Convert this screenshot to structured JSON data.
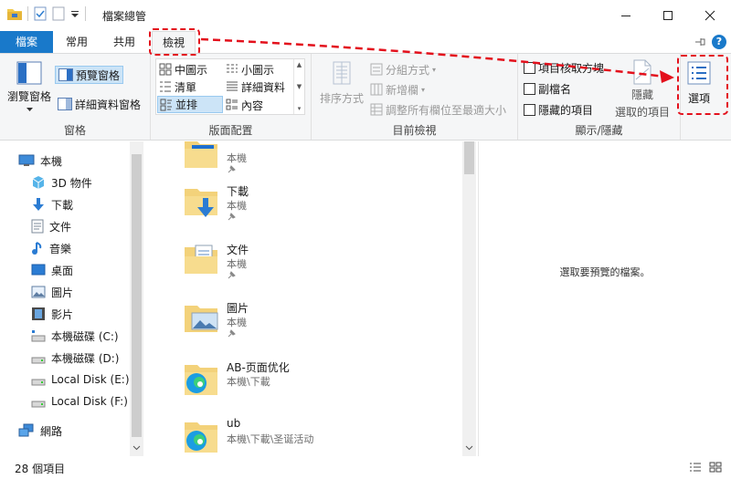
{
  "window": {
    "title": "檔案總管",
    "controls": {
      "minimize": "—",
      "maximize": "☐",
      "close": "✕"
    }
  },
  "tabs": {
    "file": "檔案",
    "home": "常用",
    "share": "共用",
    "view": "檢視"
  },
  "ribbon": {
    "panes": {
      "label": "窗格",
      "nav_pane": "瀏覽窗格",
      "preview_pane": "預覽窗格",
      "details_pane": "詳細資料窗格"
    },
    "layout": {
      "label": "版面配置",
      "items": [
        "中圖示",
        "小圖示",
        "清單",
        "詳細資料",
        "並排",
        "內容"
      ],
      "selected": "並排"
    },
    "current_view": {
      "label": "目前檢視",
      "sort_by": "排序方式",
      "group_by": "分組方式",
      "add_columns": "新增欄",
      "size_columns": "調整所有欄位至最適大小"
    },
    "show_hide": {
      "label": "顯示/隱藏",
      "item_checkboxes": "項目核取方塊",
      "file_extensions": "副檔名",
      "hidden_items": "隱藏的項目",
      "hide_selected_line1": "隱藏",
      "hide_selected_line2": "選取的項目"
    },
    "options": {
      "label": "選項"
    },
    "help": "?"
  },
  "nav": {
    "items": [
      {
        "label": "本機",
        "icon": "computer-icon"
      },
      {
        "label": "3D 物件",
        "icon": "cube-icon"
      },
      {
        "label": "下載",
        "icon": "download-icon"
      },
      {
        "label": "文件",
        "icon": "document-icon"
      },
      {
        "label": "音樂",
        "icon": "music-icon"
      },
      {
        "label": "桌面",
        "icon": "desktop-icon"
      },
      {
        "label": "圖片",
        "icon": "picture-icon"
      },
      {
        "label": "影片",
        "icon": "video-icon"
      },
      {
        "label": "本機磁碟 (C:)",
        "icon": "drive-icon"
      },
      {
        "label": "本機磁碟 (D:)",
        "icon": "drive-icon"
      },
      {
        "label": "Local Disk (E:)",
        "icon": "drive-icon"
      },
      {
        "label": "Local Disk (F:)",
        "icon": "drive-icon"
      },
      {
        "label": "網路",
        "icon": "network-icon"
      }
    ]
  },
  "files": [
    {
      "name": "",
      "location": "本機",
      "pinned": true
    },
    {
      "name": "下載",
      "location": "本機",
      "pinned": true
    },
    {
      "name": "文件",
      "location": "本機",
      "pinned": true
    },
    {
      "name": "圖片",
      "location": "本機",
      "pinned": true
    },
    {
      "name": "AB-页面优化",
      "location": "本機\\下載",
      "pinned": false
    },
    {
      "name": "ub",
      "location": "本機\\下載\\圣诞活动",
      "pinned": false
    }
  ],
  "preview": {
    "message": "選取要預覽的檔案。"
  },
  "status": {
    "count": "28 個項目"
  },
  "colors": {
    "accent": "#1979ca",
    "annotation": "#e3101c"
  }
}
